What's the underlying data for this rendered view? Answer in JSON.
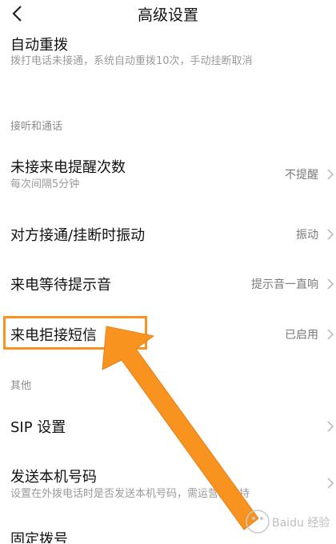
{
  "header": {
    "title": "高级设置"
  },
  "rows": {
    "auto_redial": {
      "title": "自动重拨",
      "subtitle": "拨打电话未接通，系统自动重拨10次，手动挂断取消"
    },
    "missed_call": {
      "title": "未接来电提醒次数",
      "subtitle": "每次间隔5分钟",
      "value": "不提醒"
    },
    "vibrate": {
      "title": "对方接通/挂断时振动",
      "value": "振动"
    },
    "call_waiting": {
      "title": "来电等待提示音",
      "value": "提示音一直响"
    },
    "reject_sms": {
      "title": "来电拒接短信",
      "value": "已启用"
    },
    "sip": {
      "title": "SIP 设置"
    },
    "send_number": {
      "title": "发送本机号码",
      "subtitle": "设置在外拨电话时是否发送本机号码，需运营商支持"
    },
    "fixed_dial": {
      "title": "固定拨号"
    }
  },
  "sections": {
    "calls": "接听和通话",
    "other": "其他"
  },
  "colors": {
    "highlight": "#f7931e",
    "arrow": "#f7931e"
  },
  "watermark": {
    "text": "Baidu 经验"
  }
}
